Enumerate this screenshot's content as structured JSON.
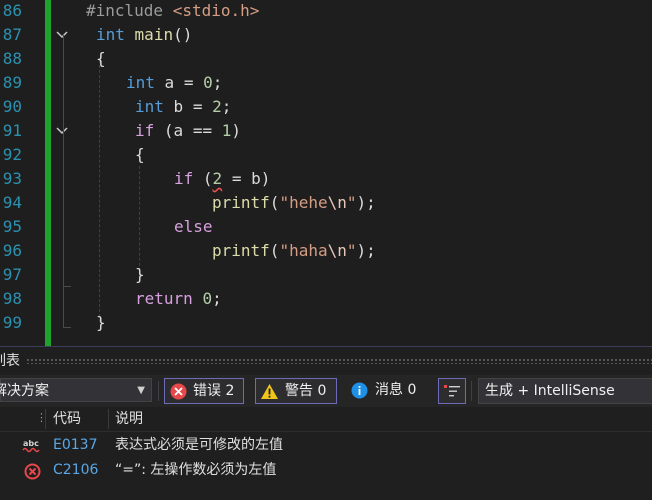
{
  "editor": {
    "line_numbers": [
      "86",
      "87",
      "88",
      "89",
      "90",
      "91",
      "92",
      "93",
      "94",
      "95",
      "96",
      "97",
      "98",
      "99"
    ],
    "code": {
      "include_directive": "#include",
      "include_header": "<stdio.h>",
      "kw_int": "int",
      "fn_main": "main",
      "parens": "()",
      "brace_open": "{",
      "brace_close": "}",
      "var_a": "a",
      "var_b": "b",
      "assign": "=",
      "equals": "==",
      "semicolon": ";",
      "num_0": "0",
      "num_1": "1",
      "num_2": "2",
      "kw_if": "if",
      "kw_else": "else",
      "kw_return": "return",
      "paren_open": "(",
      "paren_close": ")",
      "fn_printf": "printf",
      "str_hehe_pre": "\"hehe",
      "str_hehe_post": "\"",
      "str_haha_pre": "\"haha",
      "str_haha_post": "\"",
      "escape_newline": "\\n",
      "call_end": ");"
    }
  },
  "panel": {
    "title": "列表",
    "scope_value": "解决方案",
    "filters": {
      "errors": "错误 2",
      "warnings": "警告 0",
      "messages": "消息 0"
    },
    "build_value": "生成 + IntelliSense",
    "columns": {
      "code": "代码",
      "description": "说明"
    },
    "rows": [
      {
        "icon": "intellisense-error-icon",
        "code": "E0137",
        "description": "表达式必须是可修改的左值"
      },
      {
        "icon": "error-icon",
        "code": "C2106",
        "description": "“=”: 左操作数必须为左值"
      }
    ]
  },
  "colors": {
    "error_red": "#e8484a",
    "warning_yellow": "#f0c419",
    "info_blue": "#1e90e6",
    "change_bar_green": "#1fa32c"
  }
}
